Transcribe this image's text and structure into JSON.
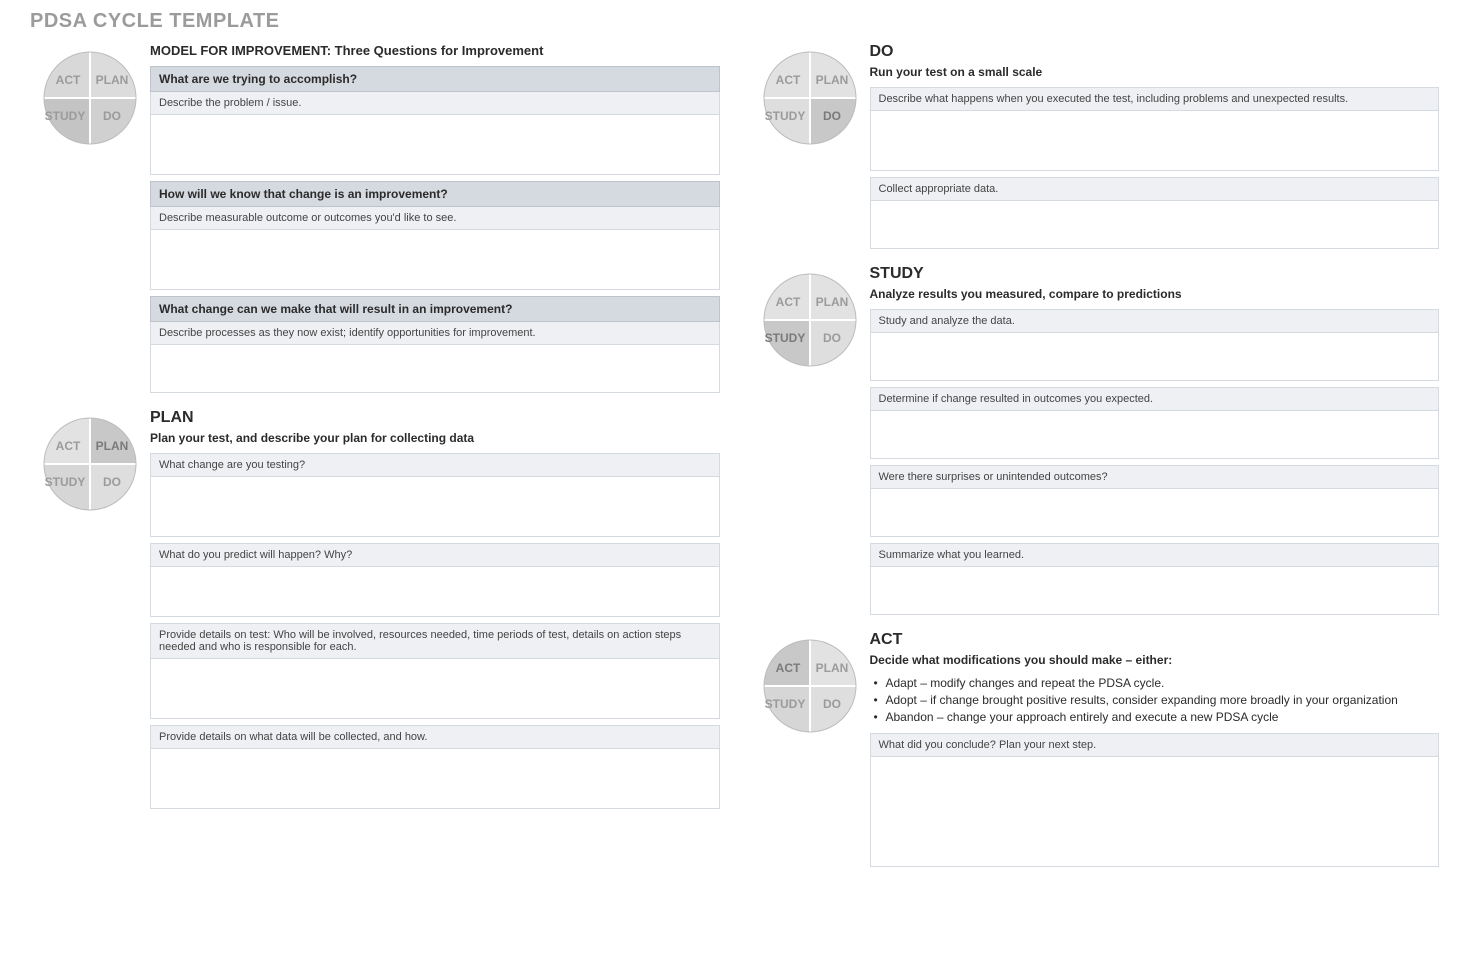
{
  "title": "PDSA CYCLE TEMPLATE",
  "wheel": {
    "act": "ACT",
    "plan": "PLAN",
    "study": "STUDY",
    "do": "DO"
  },
  "model": {
    "heading": "MODEL FOR IMPROVEMENT: Three Questions for Improvement",
    "q1": {
      "title": "What are we trying to accomplish?",
      "hint": "Describe the problem / issue."
    },
    "q2": {
      "title": "How will we know that change is an improvement?",
      "hint": "Describe measurable outcome or outcomes you'd like to see."
    },
    "q3": {
      "title": "What change can we make that will result in an improvement?",
      "hint": "Describe processes as they now exist; identify opportunities for improvement."
    }
  },
  "plan": {
    "heading": "PLAN",
    "sub": "Plan your test, and describe your plan for collecting data",
    "r1": "What change are you testing?",
    "r2": "What do you predict will happen? Why?",
    "r3": "Provide details on test: Who will be involved, resources needed, time periods of test, details on action steps needed and who is responsible for each.",
    "r4": "Provide details on what data will be collected, and how."
  },
  "do": {
    "heading": "DO",
    "sub": "Run your test on a small scale",
    "r1": "Describe what happens when you executed the test, including problems and unexpected results.",
    "r2": "Collect appropriate data."
  },
  "study": {
    "heading": "STUDY",
    "sub": "Analyze results you measured, compare to predictions",
    "r1": "Study and analyze the data.",
    "r2": "Determine if change resulted in outcomes you expected.",
    "r3": "Were there surprises or unintended outcomes?",
    "r4": "Summarize what you learned."
  },
  "act": {
    "heading": "ACT",
    "sub": "Decide what modifications you should make – either:",
    "b1": "Adapt – modify changes and repeat the PDSA cycle.",
    "b2": "Adopt – if change brought positive results, consider expanding more broadly in your organization",
    "b3": "Abandon – change your approach entirely and execute a new PDSA cycle",
    "r1": "What did you conclude? Plan your next step."
  }
}
